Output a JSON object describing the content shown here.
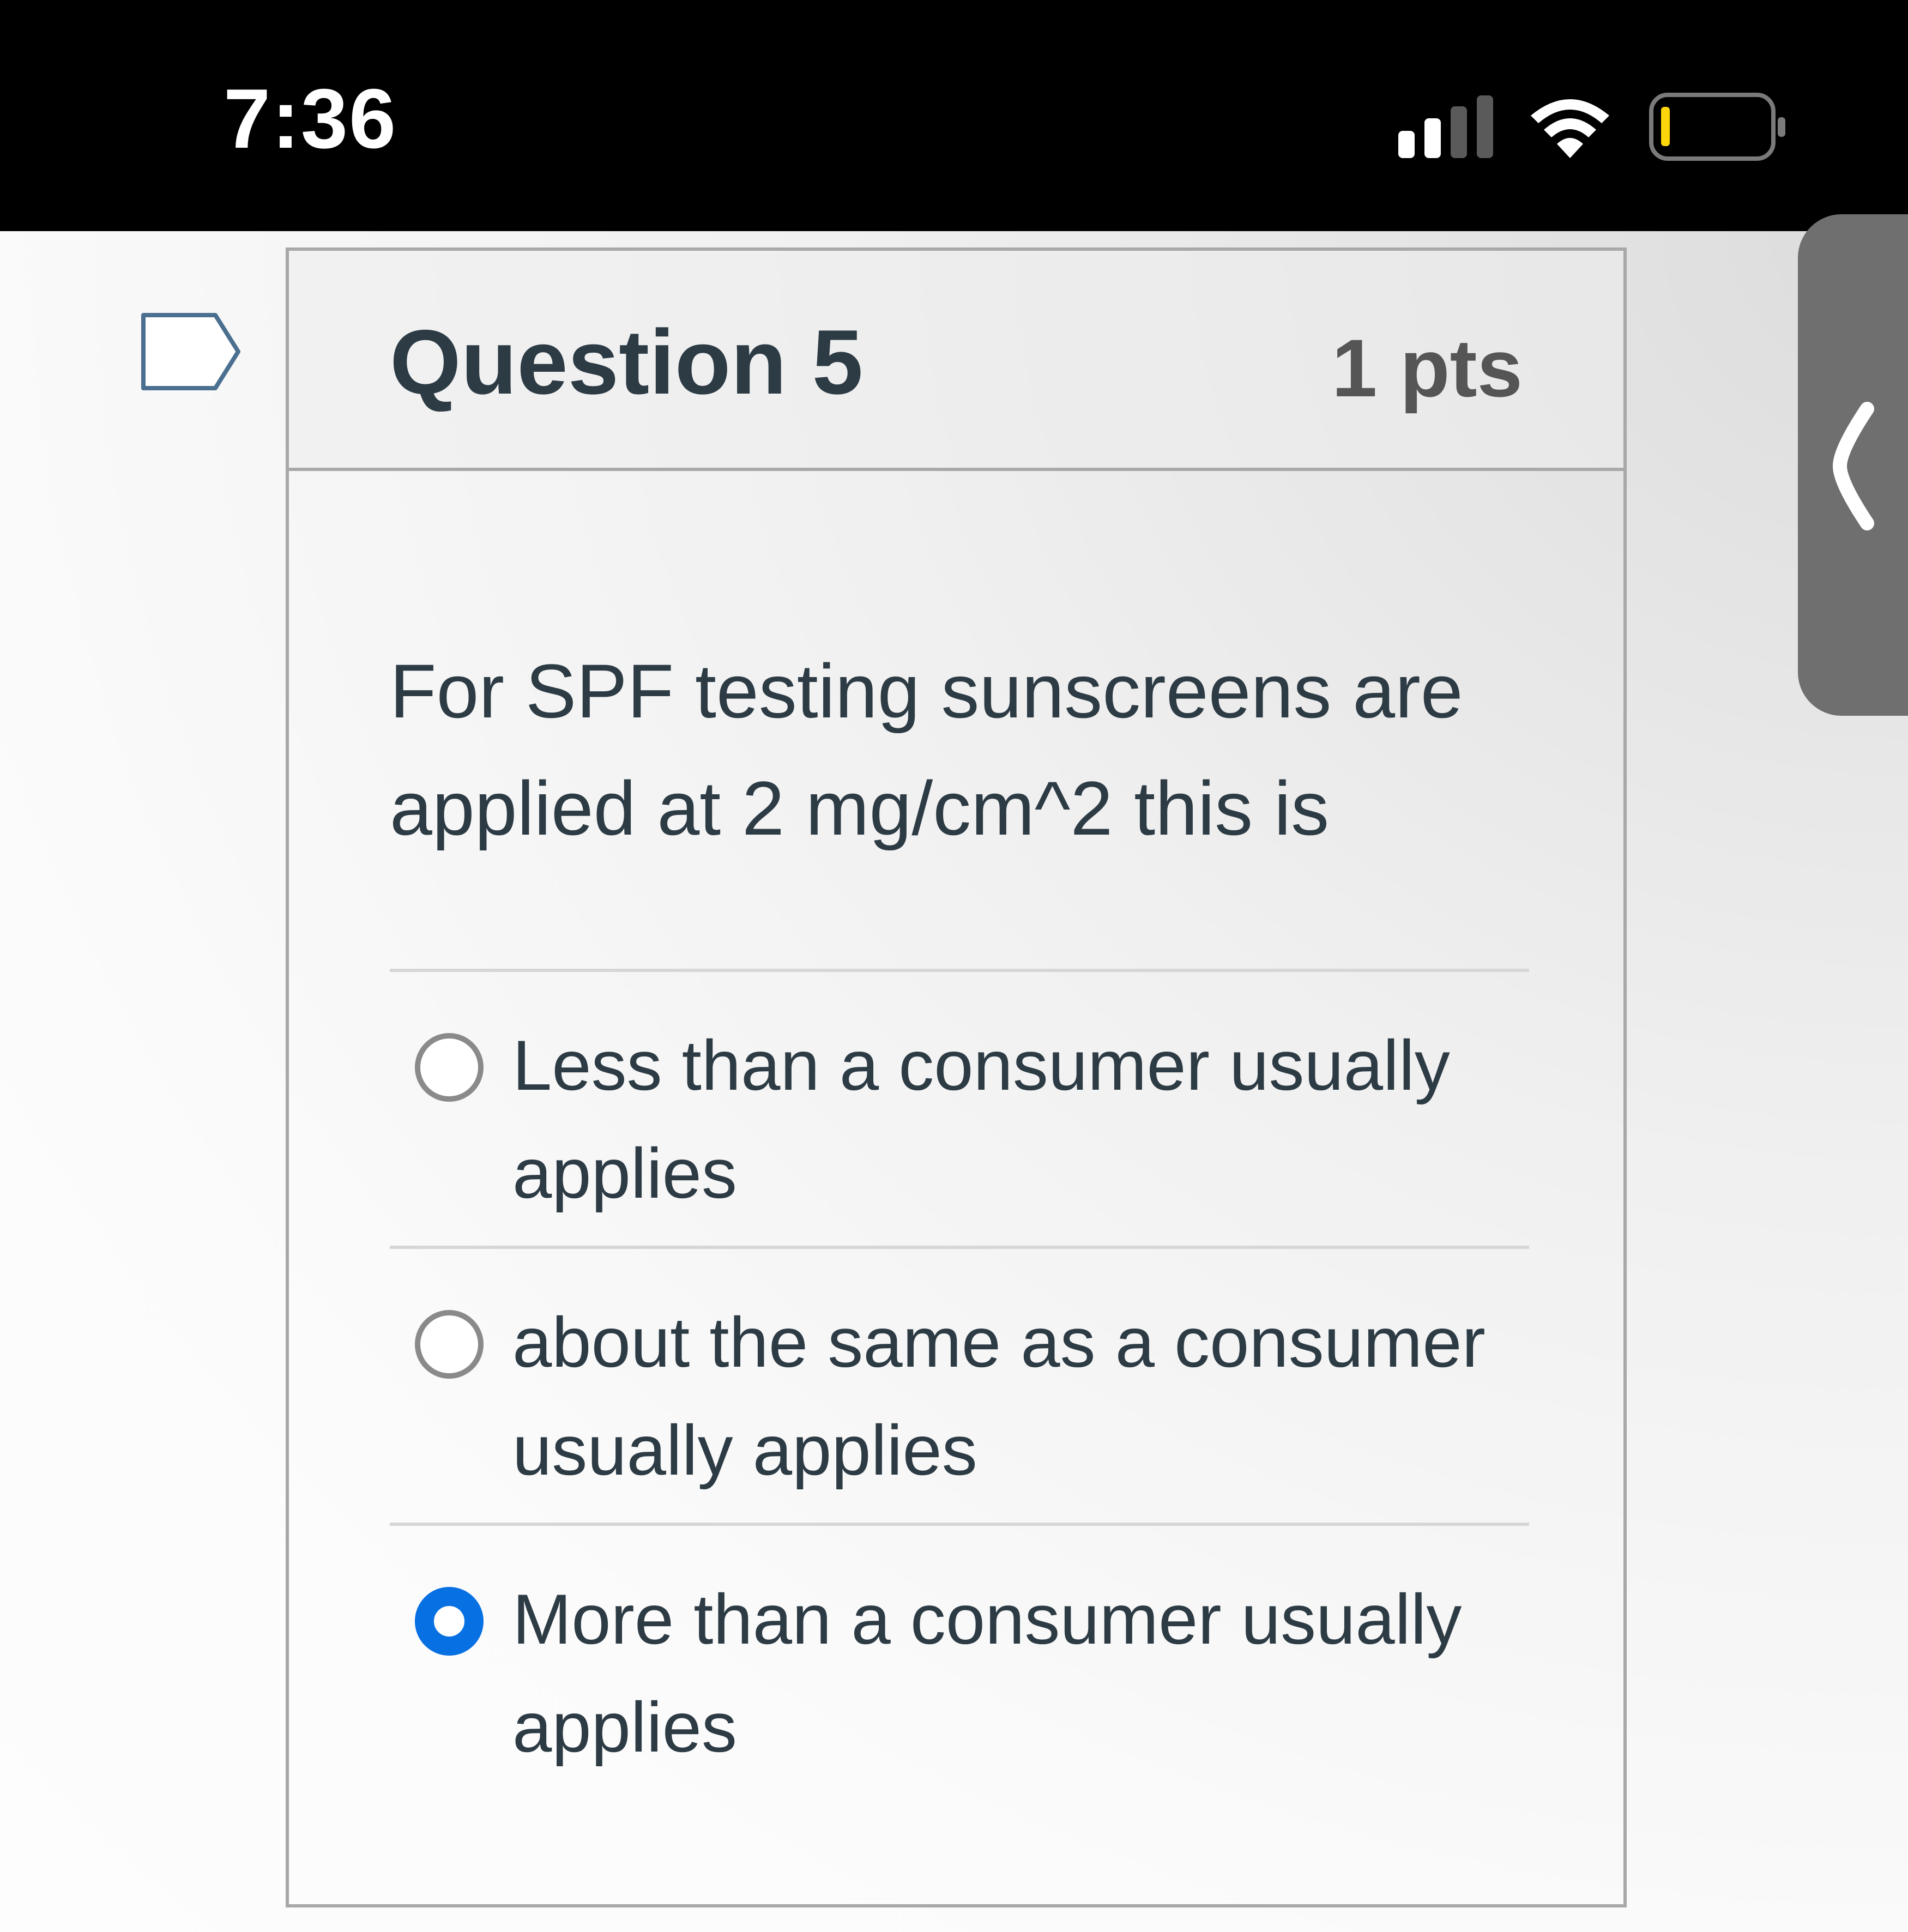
{
  "status_bar": {
    "time": "7:36",
    "icons": [
      "cellular-signal-icon",
      "wifi-icon",
      "battery-low-icon"
    ]
  },
  "flag": {
    "icon": "flag-question-icon"
  },
  "drawer": {
    "icon": "chevron-left-icon"
  },
  "question": {
    "title": "Question 5",
    "points": "1 pts",
    "text": "For SPF testing sunscreens are applied at 2 mg/cm^2 this is",
    "answers": [
      {
        "label": "Less than a consumer usually applies",
        "selected": false
      },
      {
        "label": "about the same as a consumer usually applies",
        "selected": false
      },
      {
        "label": "More than a consumer usually applies",
        "selected": true
      }
    ]
  },
  "colors": {
    "selected_radio": "#0770e3",
    "text": "#2d3b45",
    "status_bar_bg": "#000000",
    "battery_low": "#ffd60a"
  }
}
